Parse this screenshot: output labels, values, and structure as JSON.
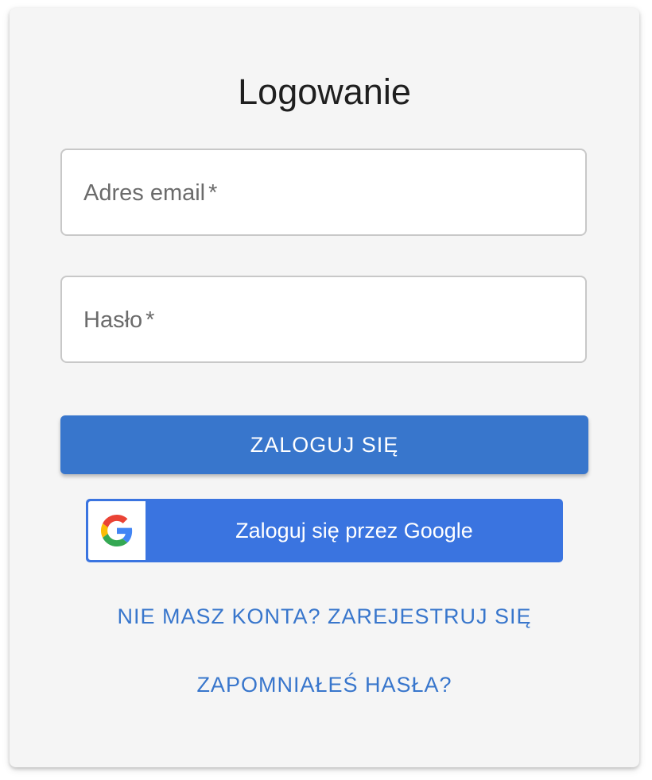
{
  "login_form": {
    "title": "Logowanie",
    "email_field": {
      "label": "Adres email",
      "required_mark": "*",
      "value": ""
    },
    "password_field": {
      "label": "Hasło",
      "required_mark": "*",
      "value": ""
    },
    "submit_label": "ZALOGUJ SIĘ",
    "google_button_label": "Zaloguj się przez Google",
    "register_link": "NIE MASZ KONTA? ZAREJESTRUJ SIĘ",
    "forgot_password_link": "ZAPOMNIAŁEŚ HASŁA?"
  },
  "icons": {
    "google": "google-g-logo"
  },
  "colors": {
    "primary": "#3876cc",
    "google_blue": "#3a74e0",
    "card_background": "#f5f5f5",
    "field_border": "#c8c8c8"
  }
}
